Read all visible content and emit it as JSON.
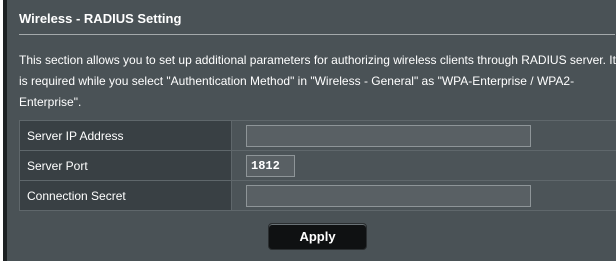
{
  "section": {
    "title": "Wireless - RADIUS Setting",
    "description": "This section allows you to set up additional parameters for authorizing wireless clients through RADIUS server. It is required while you select \"Authentication Method\" in \"Wireless - General\" as \"WPA-Enterprise / WPA2-Enterprise\"."
  },
  "fields": [
    {
      "label": "Server IP Address",
      "value": ""
    },
    {
      "label": "Server Port",
      "value": "1812"
    },
    {
      "label": "Connection Secret",
      "value": ""
    }
  ],
  "actions": {
    "apply_label": "Apply"
  }
}
